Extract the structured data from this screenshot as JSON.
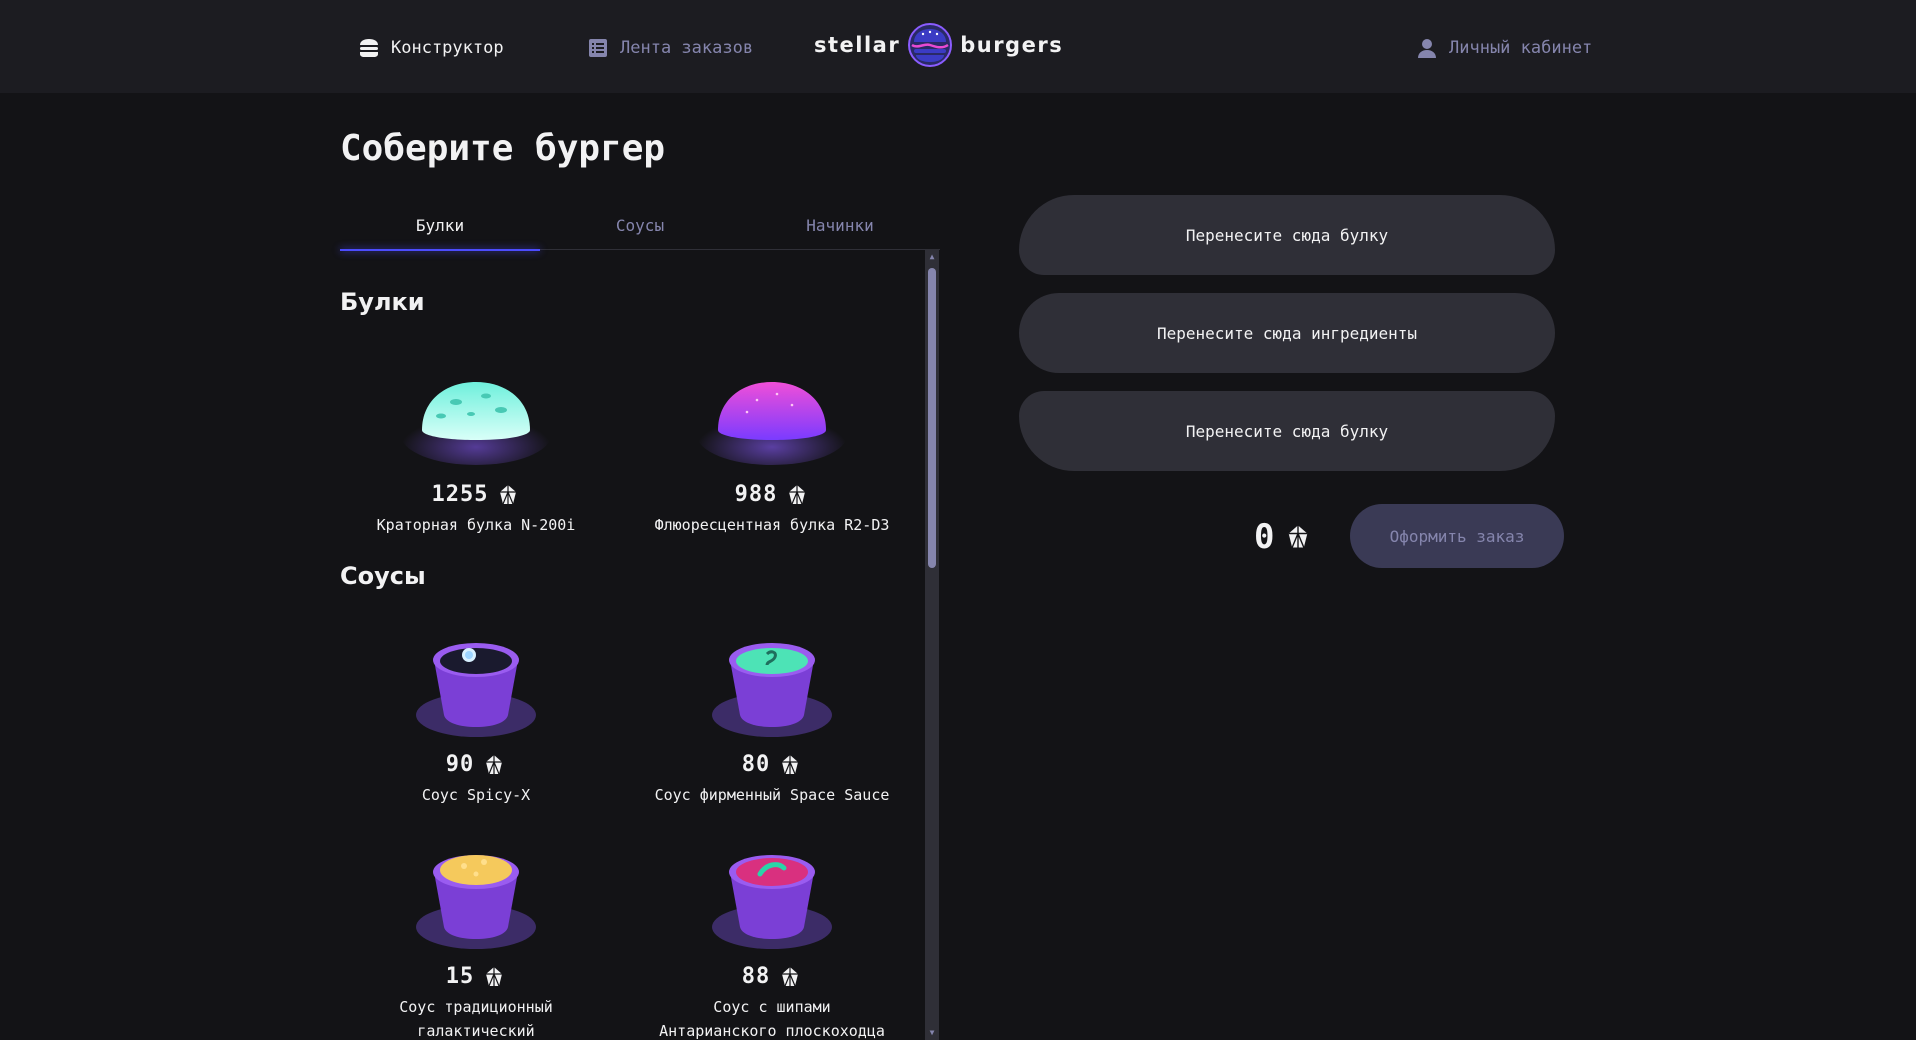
{
  "header": {
    "nav_constructor": "Конструктор",
    "nav_feed": "Лента заказов",
    "nav_profile": "Личный кабинет",
    "logo_left": "stellar",
    "logo_right": "burgers"
  },
  "main": {
    "title": "Соберите бургер",
    "tabs": [
      {
        "label": "Булки",
        "active": true
      },
      {
        "label": "Соусы",
        "active": false
      },
      {
        "label": "Начинки",
        "active": false
      }
    ],
    "sections": {
      "buns": {
        "title": "Булки",
        "items": [
          {
            "price": "1255",
            "name": "Краторная булка N-200i",
            "color": "#7ff6e2"
          },
          {
            "price": "988",
            "name": "Флюоресцентная булка R2-D3",
            "color": "#e84ad2"
          }
        ]
      },
      "sauces": {
        "title": "Соусы",
        "items": [
          {
            "price": "90",
            "name": "Соус Spicy-X",
            "color": "#1a1a2e"
          },
          {
            "price": "80",
            "name": "Соус фирменный Space Sauce",
            "color": "#4de3b6"
          },
          {
            "price": "15",
            "name_line1": "Соус традиционный",
            "name_line2": "галактический",
            "color": "#f5c95c"
          },
          {
            "price": "88",
            "name_line1": "Соус с шипами",
            "name_line2": "Антарианского плоскоходца",
            "color": "#d9307f"
          }
        ]
      }
    }
  },
  "constructor": {
    "drop_bun_top": "Перенесите сюда булку",
    "drop_ingredients": "Перенесите сюда ингредиенты",
    "drop_bun_bottom": "Перенесите сюда булку",
    "total": "0",
    "order_button": "Оформить заказ"
  },
  "colors": {
    "accent": "#4c4cff",
    "background": "#131316",
    "panel": "#1c1c21",
    "muted": "#8585ad"
  }
}
